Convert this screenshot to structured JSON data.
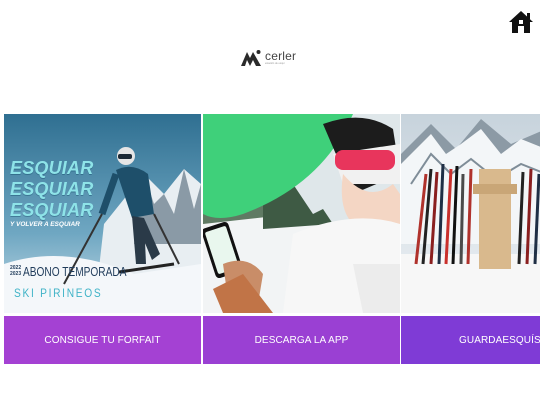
{
  "header": {
    "home_icon": "home-icon",
    "logo": {
      "wordmark": "cerler",
      "tagline": "estación de esquí"
    }
  },
  "cards": [
    {
      "button_label": "CONSIGUE TU FORFAIT",
      "promo": {
        "headline_1": "ESQUIAR",
        "headline_2": "ESQUIAR",
        "headline_3": "ESQUIAR",
        "subline": "Y VOLVER A ESQUIAR",
        "years_1": "2022",
        "years_2": "2023",
        "abono": "ABONO TEMPORADA",
        "brand": "SKI PIRINEOS"
      }
    },
    {
      "button_label": "DESCARGA LA APP"
    },
    {
      "button_label": "GUARDAESQUÍS"
    }
  ],
  "colors": {
    "button_1": "#a441d3",
    "button_2": "#9a40d3",
    "button_3": "#7f3bd6",
    "promo_cyan": "#8ee3e8"
  }
}
